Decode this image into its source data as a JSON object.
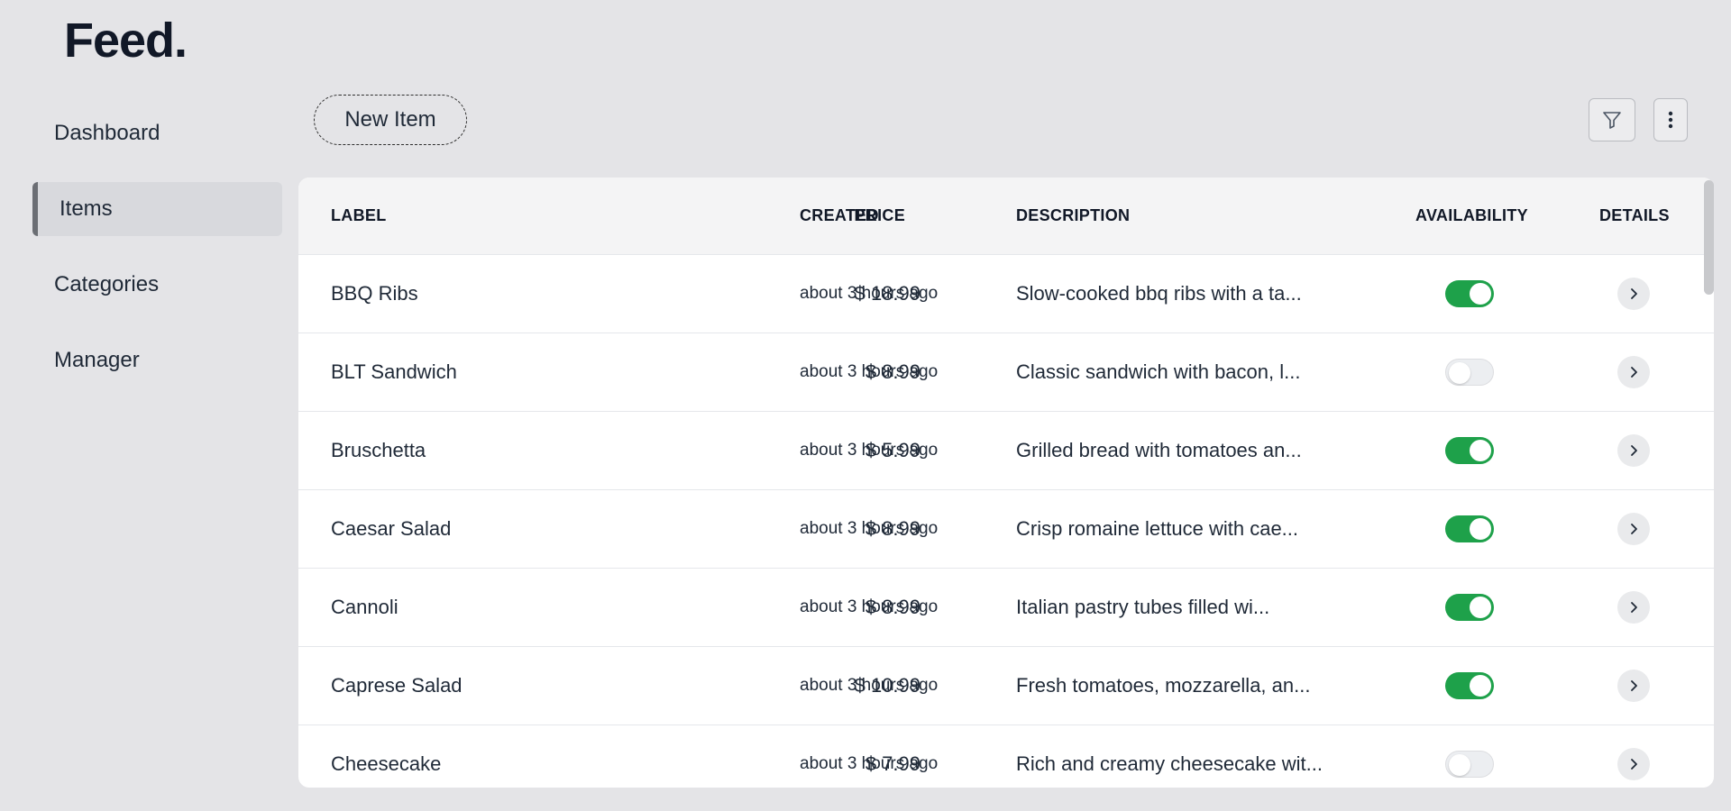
{
  "app": {
    "logo": "Feed."
  },
  "sidebar": {
    "items": [
      {
        "label": "Dashboard",
        "active": false
      },
      {
        "label": "Items",
        "active": true
      },
      {
        "label": "Categories",
        "active": false
      },
      {
        "label": "Manager",
        "active": false
      }
    ]
  },
  "toolbar": {
    "new_item_label": "New Item",
    "filter_icon": "filter-icon",
    "more_icon": "more-vertical-icon"
  },
  "table": {
    "columns": [
      "LABEL",
      "PRICE",
      "CREATED",
      "DESCRIPTION",
      "AVAILABILITY",
      "DETAILS"
    ],
    "rows": [
      {
        "label": "BBQ Ribs",
        "price": "$ 18.99",
        "created": "about 3 hours ago",
        "description": "Slow-cooked bbq ribs with a ta...",
        "available": true
      },
      {
        "label": "BLT Sandwich",
        "price": "$ 8.99",
        "created": "about 3 hours ago",
        "description": "Classic sandwich with bacon, l...",
        "available": false
      },
      {
        "label": "Bruschetta",
        "price": "$ 5.99",
        "created": "about 3 hours ago",
        "description": "Grilled bread with tomatoes an...",
        "available": true
      },
      {
        "label": "Caesar Salad",
        "price": "$ 8.99",
        "created": "about 3 hours ago",
        "description": "Crisp romaine lettuce with cae...",
        "available": true
      },
      {
        "label": "Cannoli",
        "price": "$ 8.99",
        "created": "about 3 hours ago",
        "description": "Italian pastry tubes filled wi...",
        "available": true
      },
      {
        "label": "Caprese Salad",
        "price": "$ 10.99",
        "created": "about 3 hours ago",
        "description": "Fresh tomatoes, mozzarella, an...",
        "available": true
      },
      {
        "label": "Cheesecake",
        "price": "$ 7.99",
        "created": "about 3 hours ago",
        "description": "Rich and creamy cheesecake wit...",
        "available": false
      }
    ]
  },
  "colors": {
    "toggle_on": "#1ea14a",
    "background": "#e4e4e7"
  }
}
